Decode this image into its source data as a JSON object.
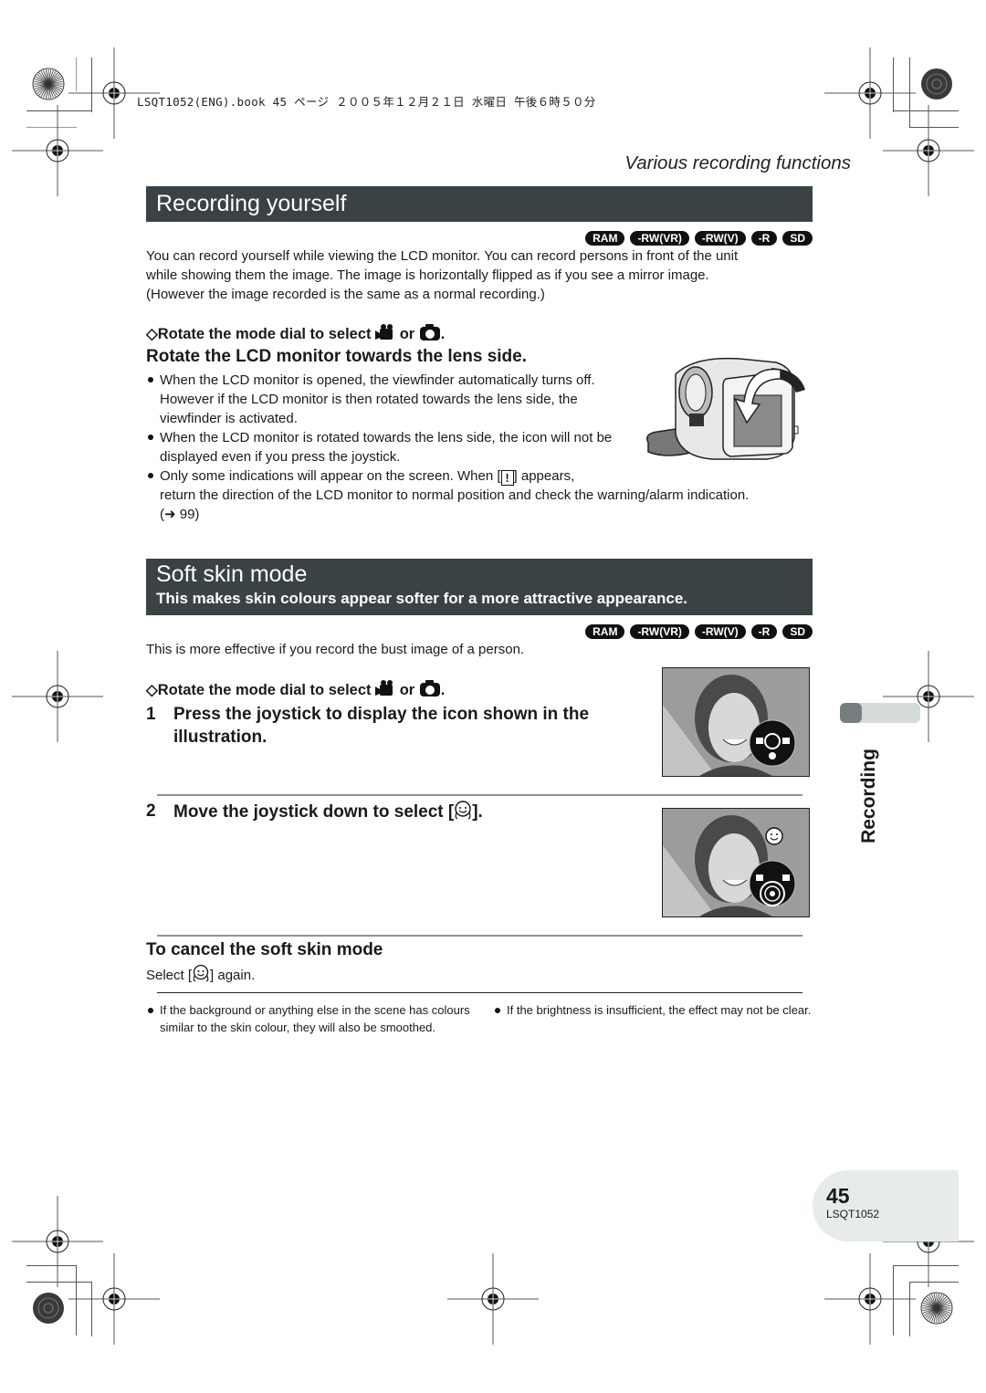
{
  "print_header": {
    "meta_line": "LSQT1052(ENG).book  45 ページ  ２００５年１２月２１日  水曜日  午後６時５０分"
  },
  "chapter_subtitle": "Various recording functions",
  "recording_yourself": {
    "title": "Recording yourself",
    "media_badges": [
      "RAM",
      "-RW(VR)",
      "-RW(V)",
      "-R",
      "SD"
    ],
    "intro": [
      "You can record yourself while viewing the LCD monitor. You can record persons in front of the unit",
      "while showing them the image. The image is horizontally flipped as if you see a mirror image.",
      "(However the image recorded is the same as a normal recording.)"
    ],
    "prereq": {
      "prefix": "Rotate the mode dial to select",
      "joiner": "or",
      "suffix": ".",
      "icons": [
        "video-camera-icon",
        "still-camera-icon"
      ]
    },
    "instruction": "Rotate the LCD monitor towards the lens side.",
    "bullets": [
      "When the LCD monitor is opened, the viewfinder automatically turns off. However if the LCD monitor is then rotated towards the lens side, the viewfinder is activated.",
      "When the LCD monitor is rotated towards the lens side, the icon will not be displayed even if you press the joystick."
    ],
    "bullet3": {
      "before": "Only some indications will appear on the screen. When [",
      "icon": "warning-icon",
      "after": "] appears,",
      "line2": "return the direction of the LCD monitor to normal position and check the warning/alarm indication.",
      "line3": "(➜ 99)"
    },
    "illustration": "camcorder-lcd-rotate-illustration"
  },
  "soft_skin": {
    "title": "Soft skin mode",
    "subtitle": "This makes skin colours appear softer for a more attractive appearance.",
    "media_badges": [
      "RAM",
      "-RW(VR)",
      "-RW(V)",
      "-R",
      "SD"
    ],
    "intro": "This is more effective if you record the bust image of a person.",
    "prereq": {
      "prefix": "Rotate the mode dial to select",
      "joiner": "or",
      "suffix": "."
    },
    "steps": [
      {
        "number": "1",
        "text_line1": "Press the joystick to display the icon shown in the",
        "text_line2": "illustration."
      },
      {
        "number": "2",
        "text_before": "Move the joystick down to select [",
        "icon": "soft-skin-icon",
        "text_after": "]."
      }
    ],
    "cancel": {
      "heading": "To cancel the soft skin mode",
      "text_before": "Select [",
      "icon": "soft-skin-icon",
      "text_after": "] again."
    },
    "notes": [
      "If the background or anything else in the scene has colours similar to the skin colour, they will also be smoothed.",
      "If the brightness is insufficient, the effect may not be clear."
    ]
  },
  "side_tab": {
    "label": "Recording"
  },
  "footer": {
    "page_number": "45",
    "doc_code": "LSQT1052"
  }
}
